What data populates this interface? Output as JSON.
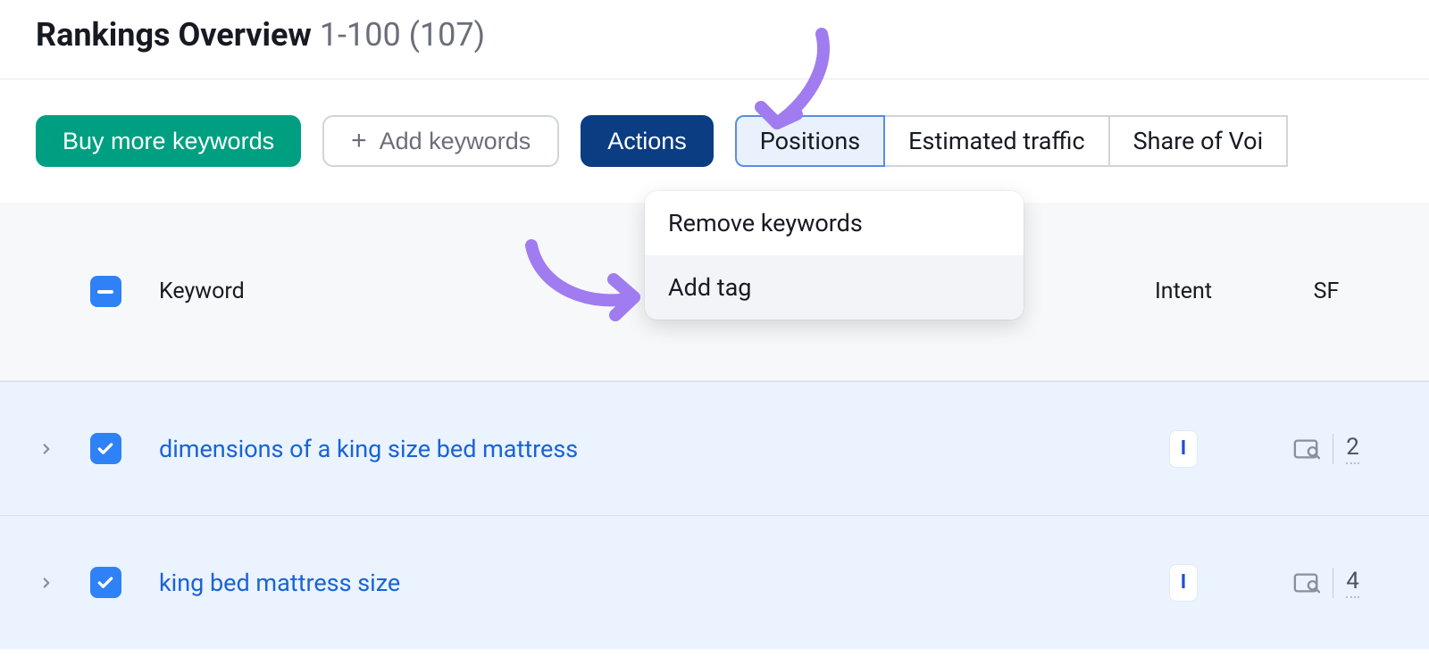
{
  "header": {
    "title_strong": "Rankings Overview",
    "title_range": "1-100",
    "title_total": "(107)"
  },
  "toolbar": {
    "buy_more": "Buy more keywords",
    "add_keywords": "Add keywords",
    "actions": "Actions",
    "tabs": {
      "positions": "Positions",
      "estimated_traffic": "Estimated traffic",
      "share_of_voice": "Share of Voi"
    }
  },
  "dropdown": {
    "remove_keywords": "Remove keywords",
    "add_tag": "Add tag"
  },
  "columns": {
    "keyword": "Keyword",
    "intent": "Intent",
    "sf": "SF"
  },
  "rows": [
    {
      "keyword": "dimensions of a king size bed mattress",
      "intent": "I",
      "sf": "2"
    },
    {
      "keyword": "king bed mattress size",
      "intent": "I",
      "sf": "4"
    }
  ]
}
